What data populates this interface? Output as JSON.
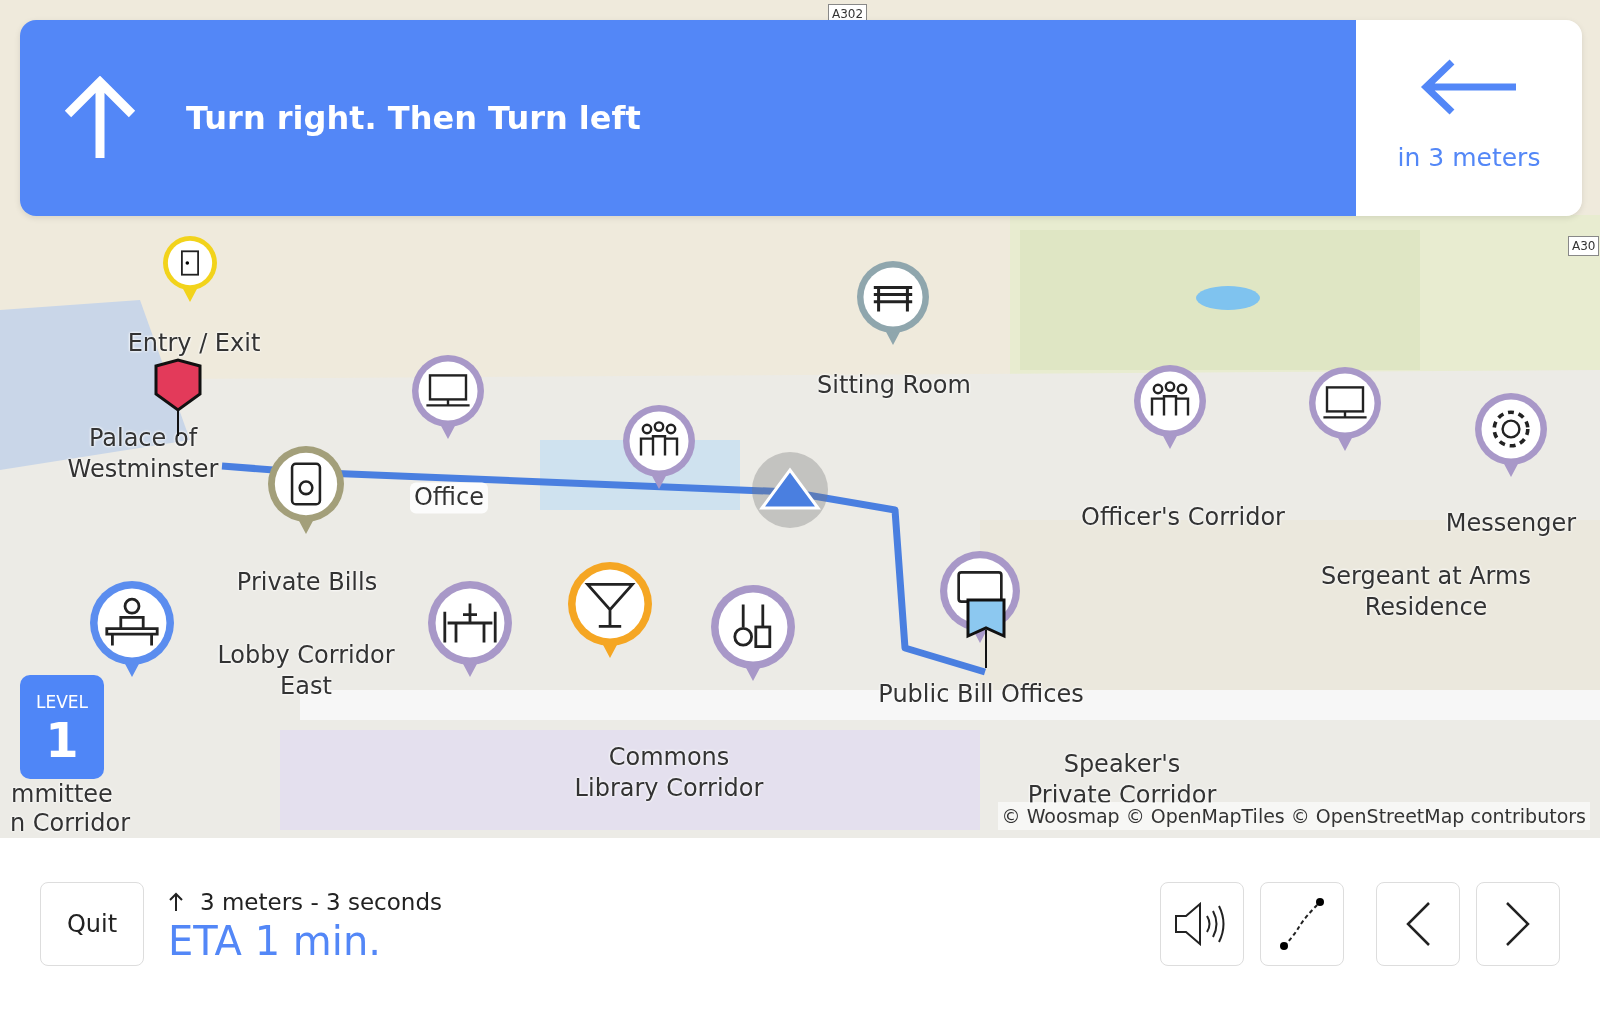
{
  "instruction": {
    "text": "Turn right. Then Turn left",
    "next_distance": "in 3 meters"
  },
  "map": {
    "labels": [
      {
        "text": "Entry / Exit"
      },
      {
        "text": "Sitting Room"
      },
      {
        "text": "Palace of Westminster"
      },
      {
        "text": "Office"
      },
      {
        "text": "Officer's Corridor"
      },
      {
        "text": "Messenger"
      },
      {
        "text": "Private Bills"
      },
      {
        "text": "Sergeant at Arms Residence"
      },
      {
        "text": "Lobby Corridor East"
      },
      {
        "text": "Public Bill Offices"
      },
      {
        "text": "mmittee"
      },
      {
        "text": "Commons Library Corridor"
      },
      {
        "text": "Speaker's Private Corridor"
      },
      {
        "text": "n Corridor"
      }
    ],
    "roads": [
      {
        "text": "A302"
      },
      {
        "text": "A30"
      }
    ],
    "pins": [
      {
        "kind": "door",
        "color": "#f2d31b"
      },
      {
        "kind": "bench",
        "color": "#8fa6ad"
      },
      {
        "kind": "computer",
        "color": "#a898c8"
      },
      {
        "kind": "people",
        "color": "#a898c8"
      },
      {
        "kind": "people",
        "color": "#a898c8"
      },
      {
        "kind": "computer",
        "color": "#a898c8"
      },
      {
        "kind": "gear",
        "color": "#a898c8"
      },
      {
        "kind": "elevator",
        "color": "#a39f7a"
      },
      {
        "kind": "reception",
        "color": "#5b8def"
      },
      {
        "kind": "table",
        "color": "#a898c8"
      },
      {
        "kind": "cocktail",
        "color": "#f5a623"
      },
      {
        "kind": "kitchen",
        "color": "#a898c8"
      },
      {
        "kind": "screen",
        "color": "#a898c8"
      }
    ],
    "level": {
      "label": "LEVEL",
      "value": "1"
    },
    "attribution": "© Woosmap © OpenMapTiles © OpenStreetMap contributors"
  },
  "footer": {
    "quit": "Quit",
    "step": "3 meters -  3 seconds",
    "eta": "ETA 1 min."
  }
}
